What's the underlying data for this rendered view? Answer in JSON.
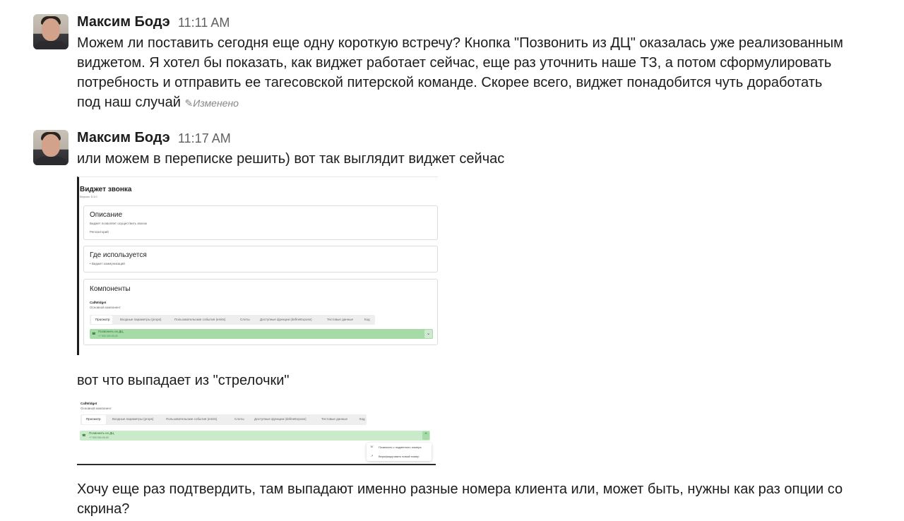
{
  "messages": [
    {
      "author": "Максим Бодэ",
      "time": "11:11 AM",
      "lines": [
        "Можем ли поставить сегодня еще одну короткую встречу? Кнопка \"Позвонить из ДЦ\" оказалась уже реализованным",
        "виджетом. Я хотел бы показать, как виджет работает сейчас, еще раз уточнить наше ТЗ, а потом сформулировать",
        "потребность и отправить ее тагесовской питерской команде. Скорее всего, виджет понадобится чуть доработать",
        "под наш случай"
      ],
      "edited_label": "Изменено"
    },
    {
      "author": "Максим Бодэ",
      "time": "11:17 AM",
      "text": "или можем в переписке решить) вот так выглядит виджет сейчас",
      "caption_2": "вот что выпадает из \"стрелочки\"",
      "followup_lines": [
        "Хочу еще раз подтвердить, там выпадают именно разные номера клиента или, может быть, нужны как раз опции со",
        "скрина?"
      ]
    }
  ],
  "screenshot_1": {
    "title": "Виджет звонка",
    "version": "Версия: 5.3.0",
    "description": {
      "heading": "Описание",
      "text": "Виджет позволяет осуществить звонок",
      "link": "Репозиторий"
    },
    "usage": {
      "heading": "Где используется",
      "item": "• Виджет коммуникаций"
    },
    "components": {
      "heading": "Компоненты",
      "name": "CallWidget",
      "sub": "Основной компонент"
    }
  },
  "widget_tabs": [
    "Просмотр",
    "Входные параметры (props)",
    "Пользовательские события (emits)",
    "Слоты",
    "Доступные функции (defineExpose)",
    "Тестовые данные",
    "Код"
  ],
  "call_bar": {
    "title": "Позвонить из ДЦ",
    "phone": "+7 900 000-00-00"
  },
  "screenshot_2": {
    "name": "CallWidget",
    "sub": "Основной компонент",
    "menu_items": [
      "Позвонить с подменного номера",
      "Верифицировать новый номер"
    ]
  },
  "colors": {
    "call_bar": "#a6dba8",
    "tab_bar": "#eeeeee"
  }
}
